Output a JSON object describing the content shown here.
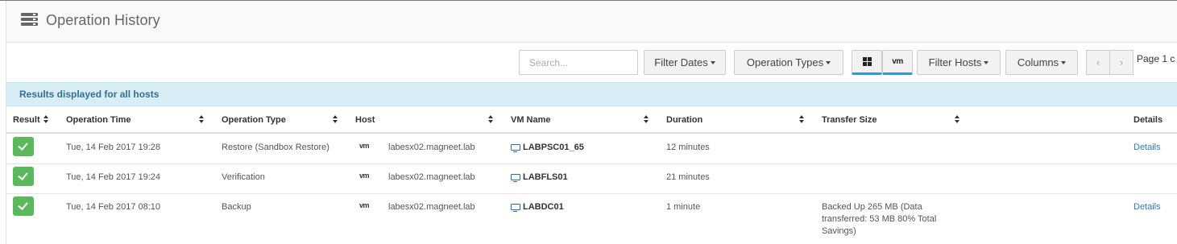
{
  "header": {
    "title": "Operation History",
    "icon": "server-list-icon"
  },
  "toolbar": {
    "search_placeholder": "Search...",
    "filter_dates": "Filter Dates",
    "operation_types": "Operation Types",
    "windows_icon": "windows-icon",
    "vm_label": "vm",
    "filter_hosts": "Filter Hosts",
    "columns": "Columns",
    "prev": "‹",
    "next": "›",
    "page_info": "Page 1 c"
  },
  "banner": {
    "text": "Results displayed for all hosts"
  },
  "table": {
    "columns": [
      "Result",
      "Operation Time",
      "Operation Type",
      "Host",
      "VM Name",
      "Duration",
      "Transfer Size",
      "Details"
    ],
    "rows": [
      {
        "result": "success",
        "time": "Tue, 14 Feb 2017 19:28",
        "type": "Restore (Sandbox Restore)",
        "host_icon": "vm",
        "host": "labesx02.magneet.lab",
        "vm": "LABPSC01_65",
        "duration": "12 minutes",
        "transfer": "",
        "details": "Details"
      },
      {
        "result": "success",
        "time": "Tue, 14 Feb 2017 19:24",
        "type": "Verification",
        "host_icon": "vm",
        "host": "labesx02.magneet.lab",
        "vm": "LABFLS01",
        "duration": "21 minutes",
        "transfer": "",
        "details": ""
      },
      {
        "result": "success",
        "time": "Tue, 14 Feb 2017 08:10",
        "type": "Backup",
        "host_icon": "vm",
        "host": "labesx02.magneet.lab",
        "vm": "LABDC01",
        "duration": "1 minute",
        "transfer": "Backed Up 265 MB (Data transferred: 53 MB 80% Total Savings)",
        "details": "Details"
      }
    ]
  },
  "colors": {
    "accent": "#2f9bd6",
    "success": "#5cb85c",
    "banner_bg": "#d9edf7",
    "banner_text": "#31708f",
    "link": "#2a7bb6"
  }
}
